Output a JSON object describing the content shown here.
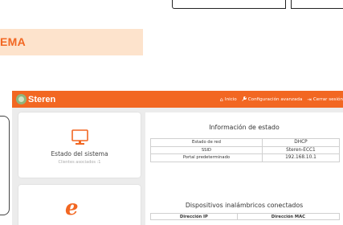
{
  "banner": {
    "title": "EMA"
  },
  "app": {
    "logo_text": "Steren",
    "nav": [
      {
        "icon": "home-icon",
        "glyph": "⌂",
        "label": "Inicio"
      },
      {
        "icon": "wrench-icon",
        "glyph": "🔧",
        "label": "Configuración avanzada"
      },
      {
        "icon": "logout-icon",
        "glyph": "⇥",
        "label": "Cerrar sesión"
      }
    ],
    "sidebar": {
      "cards": [
        {
          "icon": "monitor-icon",
          "title": "Estado del sistema",
          "subtitle": "Clientes asociados :1"
        },
        {
          "icon": "ie-browser-icon",
          "glyph": "e"
        }
      ]
    },
    "status": {
      "title": "Información de estado",
      "rows": [
        {
          "label": "Estado de red",
          "value": "DHCP"
        },
        {
          "label": "SSID",
          "value": "Steren-ECC1"
        },
        {
          "label": "Portal predeterminado",
          "value": "192.168.10.1"
        }
      ]
    },
    "devices": {
      "title": "Dispositivos inalámbricos conectados",
      "columns": [
        "Dirección IP",
        "Dirección MAC"
      ]
    }
  },
  "colors": {
    "accent": "#f26722",
    "banner_bg": "#fde3cc",
    "page_bg": "#ececec"
  }
}
